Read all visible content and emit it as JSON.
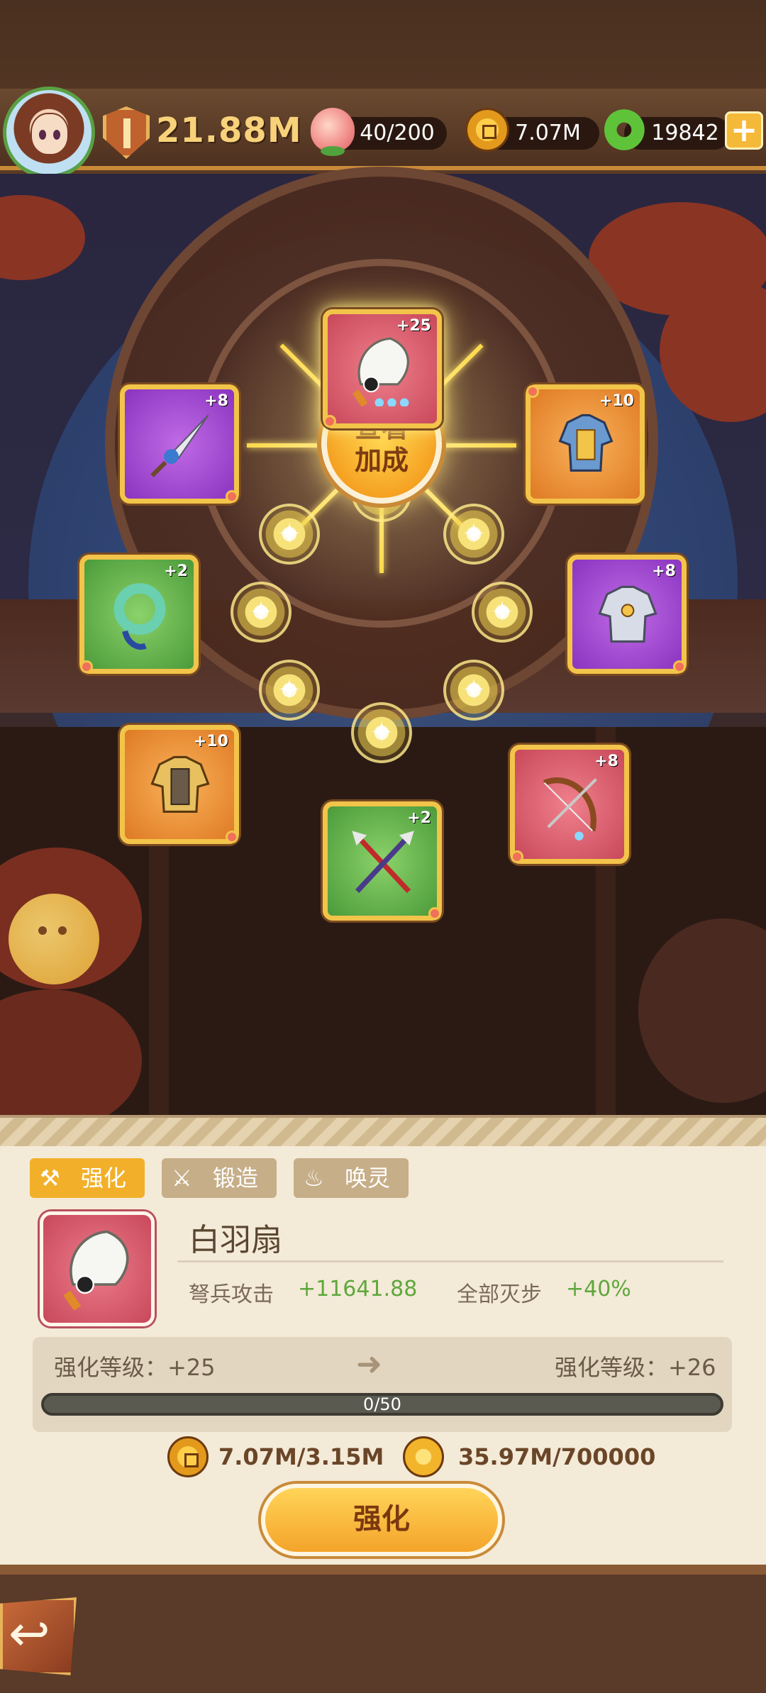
{
  "header": {
    "power": "21.88M",
    "stamina": "40/200",
    "coins": "7.07M",
    "jade": "19842",
    "plus": "+"
  },
  "wheel": {
    "center_line1": "查看",
    "center_line2": "加成",
    "slots": [
      {
        "id": "fan",
        "level": "+25",
        "color": "red"
      },
      {
        "id": "armor-blue",
        "level": "+10",
        "color": "orange"
      },
      {
        "id": "armor-silver",
        "level": "+8",
        "color": "purple"
      },
      {
        "id": "bow",
        "level": "+8",
        "color": "red"
      },
      {
        "id": "twin-spears",
        "level": "+2",
        "color": "green"
      },
      {
        "id": "armor-gold",
        "level": "+10",
        "color": "orange"
      },
      {
        "id": "jade-ring",
        "level": "+2",
        "color": "green"
      },
      {
        "id": "dagger",
        "level": "+8",
        "color": "purple"
      }
    ]
  },
  "tabs": [
    {
      "label": "强化",
      "icon": "hammer-icon",
      "active": true
    },
    {
      "label": "锻造",
      "icon": "anvil-icon",
      "active": false
    },
    {
      "label": "唤灵",
      "icon": "flame-icon",
      "active": false
    }
  ],
  "item": {
    "name": "白羽扇",
    "stat1_label": "弩兵攻击",
    "stat1_value": "+11641.88",
    "stat2_label": "全部灭步",
    "stat2_value": "+40%"
  },
  "enhance": {
    "current_label": "强化等级：+25",
    "next_label": "强化等级：+26",
    "progress_text": "0/50",
    "progress_fraction": 0,
    "cost_coins": "7.07M/3.15M",
    "cost_material": "35.97M/700000",
    "button": "强化"
  },
  "colors": {
    "accent": "#f2b02a",
    "stat_green": "#5ea83c",
    "panel": "#f4ead8"
  }
}
